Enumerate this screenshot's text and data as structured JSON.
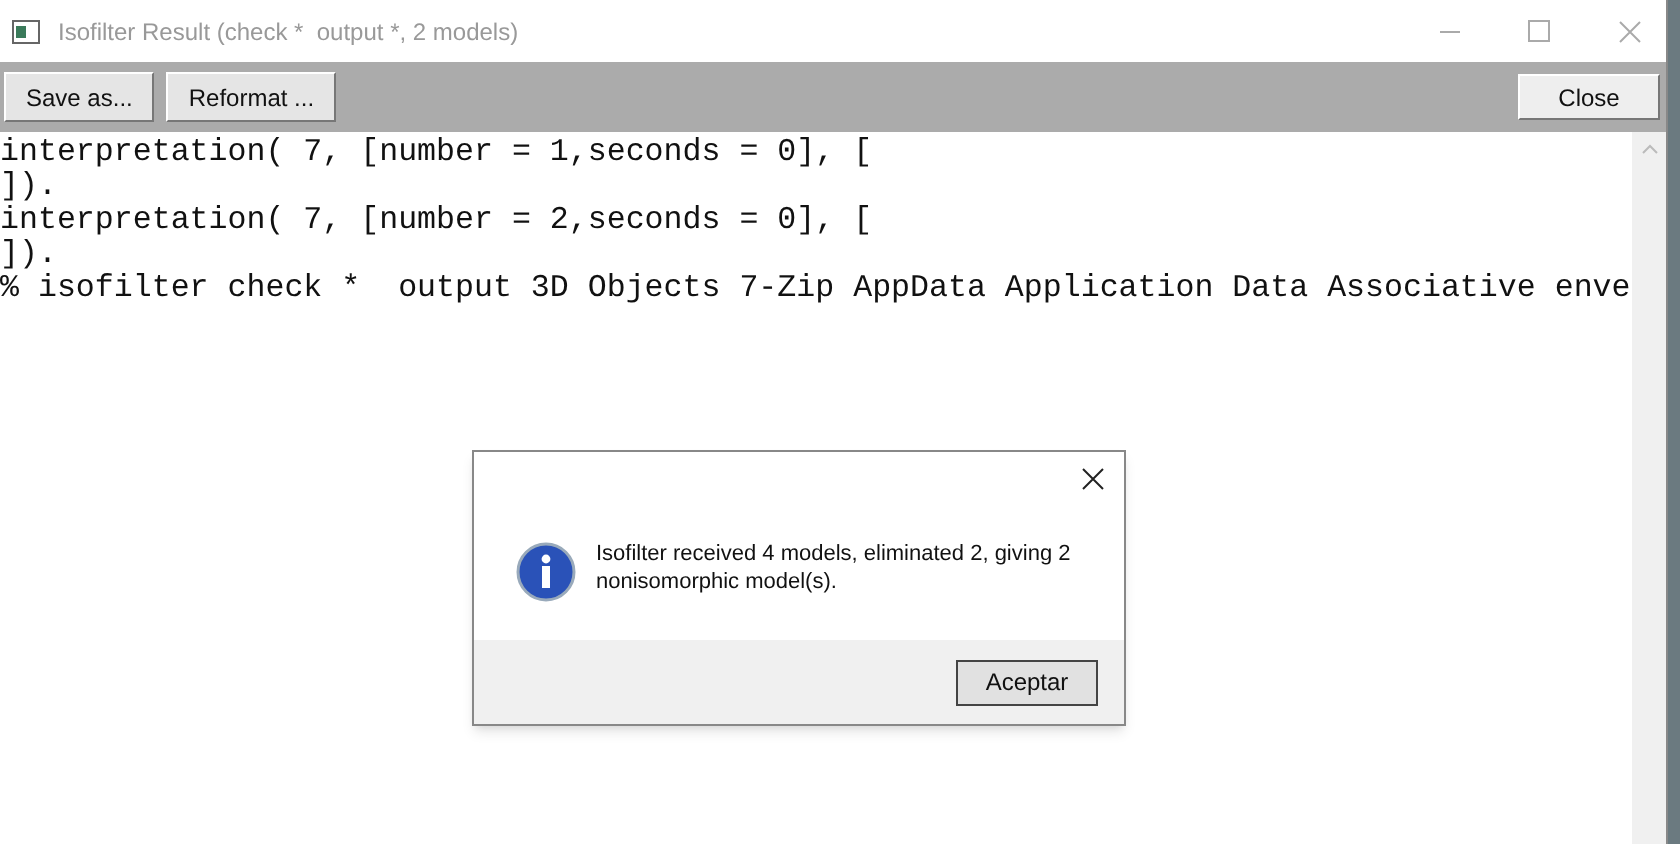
{
  "window": {
    "title": "Isofilter Result (check *  output *, 2 models)"
  },
  "toolbar": {
    "left_buttons": [
      "Save as...",
      "Reformat ..."
    ],
    "right_button": "Close"
  },
  "output_lines": [
    "interpretation( 7, [number = 1,seconds = 0], [",
    "]).",
    "interpretation( 7, [number = 2,seconds = 0], [",
    "]).",
    "% isofilter check *  output 3D Objects 7-Zip AppData Application Data Associative enve"
  ],
  "dialog": {
    "message": "Isofilter received 4 models, eliminated 2, giving 2 nonisomorphic model(s).",
    "button": "Aceptar"
  }
}
